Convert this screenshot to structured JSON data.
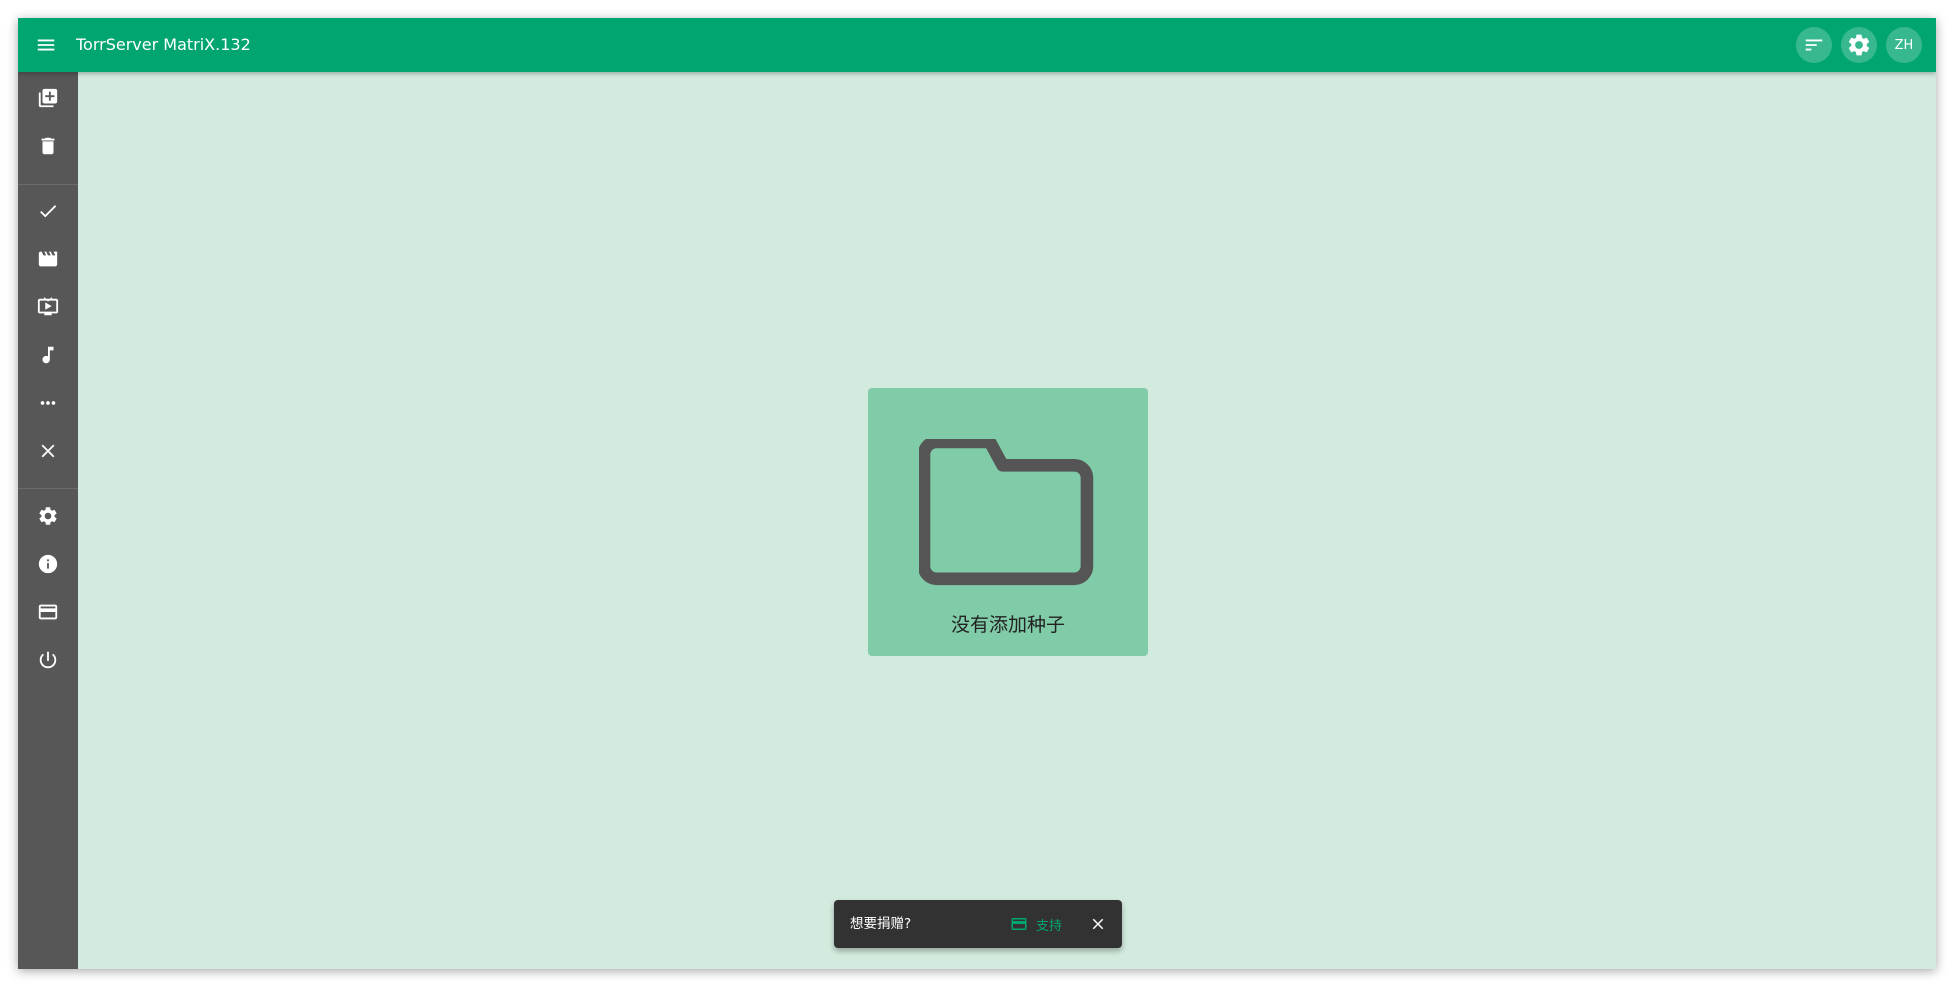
{
  "header": {
    "title": "TorrServer MatriX.132",
    "menu_icon": "hamburger-menu-icon",
    "actions": {
      "sort_icon": "sort-icon",
      "settings_icon": "gear-icon",
      "language_label": "ZH"
    }
  },
  "sidebar": {
    "items": [
      {
        "name": "add-torrent",
        "icon": "library-add-icon"
      },
      {
        "name": "remove-all",
        "icon": "trash-icon"
      },
      {
        "name": "filter-all",
        "icon": "check-icon"
      },
      {
        "name": "filter-movies",
        "icon": "clapperboard-icon"
      },
      {
        "name": "filter-series",
        "icon": "tv-icon"
      },
      {
        "name": "filter-music",
        "icon": "music-note-icon"
      },
      {
        "name": "filter-other",
        "icon": "more-horizontal-icon"
      },
      {
        "name": "close-server",
        "icon": "close-icon"
      },
      {
        "name": "settings",
        "icon": "gear-icon"
      },
      {
        "name": "about",
        "icon": "info-icon"
      },
      {
        "name": "donate",
        "icon": "credit-card-icon"
      },
      {
        "name": "shutdown",
        "icon": "power-icon"
      }
    ]
  },
  "main": {
    "empty_state": {
      "icon": "folder-icon",
      "text": "没有添加种子"
    }
  },
  "snackbar": {
    "message": "想要捐赠?",
    "action_label": "支持",
    "action_icon": "credit-card-icon",
    "close_icon": "close-icon"
  },
  "colors": {
    "primary": "#00a572",
    "sidebar": "#575757",
    "background": "#d2ebde",
    "card": "#81cca8",
    "snackbar": "#323232"
  }
}
